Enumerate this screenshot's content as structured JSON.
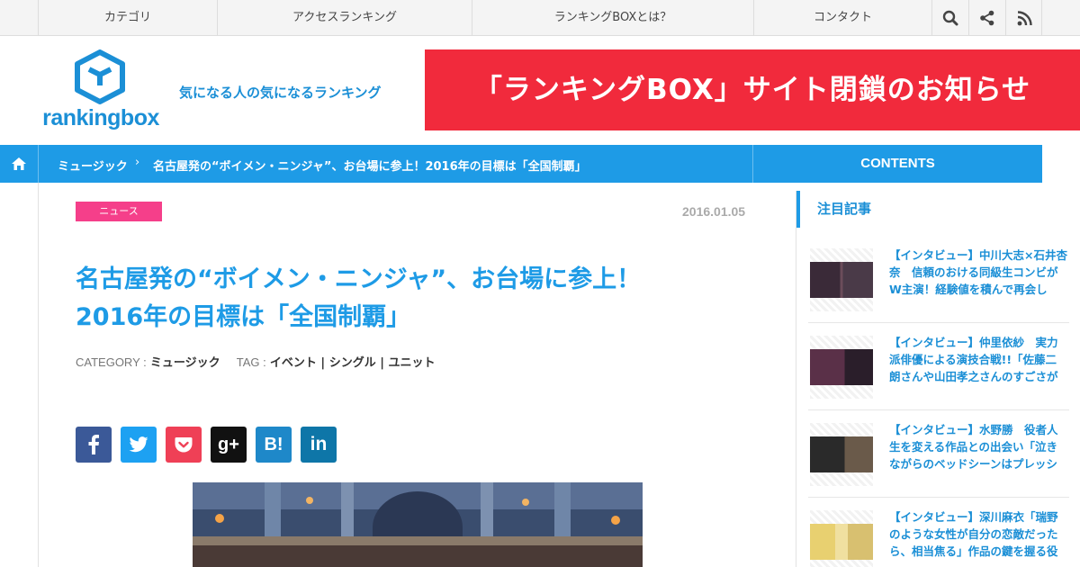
{
  "nav": {
    "items": [
      "カテゴリ",
      "アクセスランキング",
      "ランキングBOXとは？",
      "コンタクト"
    ],
    "icons": [
      "search-icon",
      "share-icon",
      "rss-icon"
    ]
  },
  "header": {
    "logo_text": "rankingbox",
    "tagline": "気になる人の気になるランキング",
    "banner": "「ランキングBOX」サイト閉鎖のお知らせ"
  },
  "breadcrumb": {
    "category": "ミュージック",
    "separator": "›",
    "title": "名古屋発の“ボイメン・ニンジャ”、お台場に参上！2016年の目標は「全国制覇」",
    "contents": "CONTENTS"
  },
  "article": {
    "badge": "ニュース",
    "date": "2016.01.05",
    "title_line1": "名古屋発の“ボイメン・ニンジャ”、お台場に参上！",
    "title_line2": "2016年の目標は「全国制覇」",
    "category_label": "CATEGORY :",
    "category": "ミュージック",
    "tag_label": "TAG :",
    "tags": "イベント | シングル | ユニット",
    "share": [
      "f",
      "t",
      "pocket",
      "g+",
      "B!",
      "in"
    ]
  },
  "sidebar": {
    "heading": "注目記事",
    "items": [
      {
        "text": "【インタビュー】中川大志×石井杏奈　信頼のおける同級生コンビがW主演！経験値を積んで再会し"
      },
      {
        "text": "【インタビュー】仲里依紗　実力派俳優による演技合戦!!「佐藤二朗さんや山田孝之さんのすごさが"
      },
      {
        "text": "【インタビュー】水野勝　役者人生を変える作品との出会い「泣きながらのベッドシーンはプレッシ"
      },
      {
        "text": "【インタビュー】深川麻衣「瑞野のような女性が自分の恋敵だったら、相当焦る」作品の鍵を握る役"
      }
    ]
  },
  "colors": {
    "accent": "#1e9be6",
    "banner": "#f12a3c",
    "badge": "#f53f8a"
  }
}
